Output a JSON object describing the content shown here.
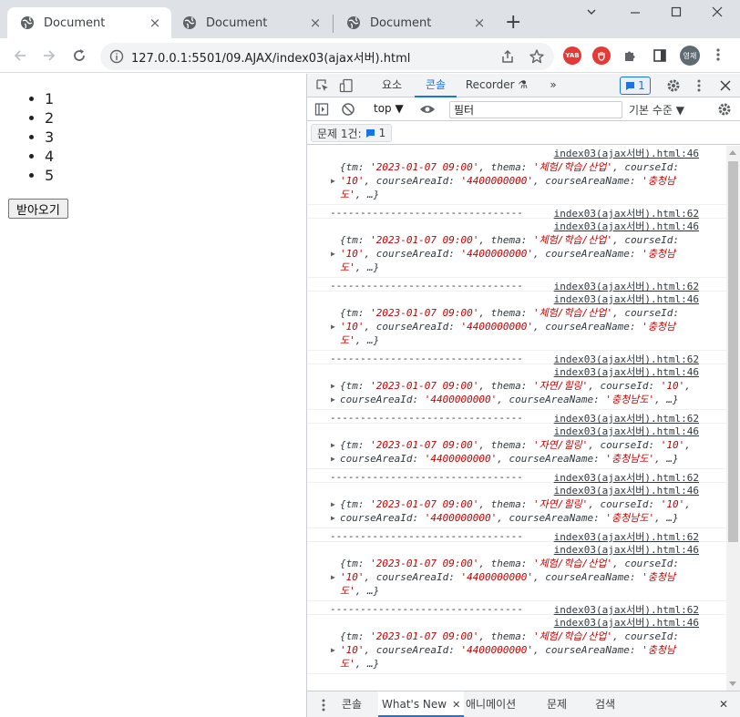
{
  "browser": {
    "tabs": [
      {
        "title": "Document",
        "close": "×"
      },
      {
        "title": "Document",
        "close": "×"
      },
      {
        "title": "Document",
        "close": "×"
      }
    ],
    "new_tab": "+",
    "window_controls": {
      "minimize": "—",
      "maximize": "☐",
      "close": "✕"
    },
    "url": "127.0.0.1:5501/09.AJAX/index03(ajax서버).html",
    "extensions": [
      {
        "label": "YAB",
        "color": "#e53935"
      },
      {
        "label": "",
        "color": "#e53935"
      }
    ],
    "profile_initials": "영재"
  },
  "page": {
    "list_items": [
      "1",
      "2",
      "3",
      "4",
      "5"
    ],
    "fetch_button": "받아오기"
  },
  "devtools": {
    "tabs": [
      "요소",
      "콘솔",
      "Recorder ⚗"
    ],
    "more_tabs": "»",
    "issue_count": "1",
    "context": "top ▼",
    "filter_placeholder": "필터",
    "level": "기본 수준 ▼",
    "issues_label": "문제 1건:",
    "issues_count": "1",
    "drawer_tabs": [
      "콘솔",
      "What's New",
      "애니메이션",
      "문제",
      "검색"
    ],
    "drawer_close": "✕",
    "drawer_tab_close": "✕"
  },
  "console": {
    "separator": "--------------------------------",
    "messages": [
      {
        "src": "index03(ajax서버).html:46",
        "lines": [
          [
            "{tm: ",
            "'2023-01-07 09:00'",
            ", thema: ",
            "'체험/학습/산업'",
            ", courseId:"
          ],
          [
            "",
            "'10'",
            ", courseAreaId: ",
            "'4400000000'",
            ", courseAreaName: ",
            "'충청남"
          ],
          [
            "",
            "도'",
            ", …}"
          ]
        ],
        "sep_src": "index03(ajax서버).html:62"
      },
      {
        "src": "index03(ajax서버).html:46",
        "lines": [
          [
            "{tm: ",
            "'2023-01-07 09:00'",
            ", thema: ",
            "'체험/학습/산업'",
            ", courseId:"
          ],
          [
            "",
            "'10'",
            ", courseAreaId: ",
            "'4400000000'",
            ", courseAreaName: ",
            "'충청남"
          ],
          [
            "",
            "도'",
            ", …}"
          ]
        ],
        "sep_src": "index03(ajax서버).html:62"
      },
      {
        "src": "index03(ajax서버).html:46",
        "lines": [
          [
            "{tm: ",
            "'2023-01-07 09:00'",
            ", thema: ",
            "'체험/학습/산업'",
            ", courseId:"
          ],
          [
            "",
            "'10'",
            ", courseAreaId: ",
            "'4400000000'",
            ", courseAreaName: ",
            "'충청남"
          ],
          [
            "",
            "도'",
            ", …}"
          ]
        ],
        "sep_src": "index03(ajax서버).html:62"
      },
      {
        "src": "index03(ajax서버).html:46",
        "lines": [
          [
            "{tm: ",
            "'2023-01-07 09:00'",
            ", thema: ",
            "'자연/힐링'",
            ", courseId: ",
            "'10'",
            ","
          ],
          [
            "courseAreaId: ",
            "'4400000000'",
            ", courseAreaName: ",
            "'충청남도'",
            ", …}"
          ]
        ],
        "sep_src": "index03(ajax서버).html:62"
      },
      {
        "src": "index03(ajax서버).html:46",
        "lines": [
          [
            "{tm: ",
            "'2023-01-07 09:00'",
            ", thema: ",
            "'자연/힐링'",
            ", courseId: ",
            "'10'",
            ","
          ],
          [
            "courseAreaId: ",
            "'4400000000'",
            ", courseAreaName: ",
            "'충청남도'",
            ", …}"
          ]
        ],
        "sep_src": "index03(ajax서버).html:62"
      },
      {
        "src": "index03(ajax서버).html:46",
        "lines": [
          [
            "{tm: ",
            "'2023-01-07 09:00'",
            ", thema: ",
            "'자연/힐링'",
            ", courseId: ",
            "'10'",
            ","
          ],
          [
            "courseAreaId: ",
            "'4400000000'",
            ", courseAreaName: ",
            "'충청남도'",
            ", …}"
          ]
        ],
        "sep_src": "index03(ajax서버).html:62"
      },
      {
        "src": "index03(ajax서버).html:46",
        "lines": [
          [
            "{tm: ",
            "'2023-01-07 09:00'",
            ", thema: ",
            "'체험/학습/산업'",
            ", courseId:"
          ],
          [
            "",
            "'10'",
            ", courseAreaId: ",
            "'4400000000'",
            ", courseAreaName: ",
            "'충청남"
          ],
          [
            "",
            "도'",
            ", …}"
          ]
        ],
        "sep_src": "index03(ajax서버).html:62"
      },
      {
        "src": "index03(ajax서버).html:46",
        "lines": [
          [
            "{tm: ",
            "'2023-01-07 09:00'",
            ", thema: ",
            "'체험/학습/산업'",
            ", courseId:"
          ],
          [
            "",
            "'10'",
            ", courseAreaId: ",
            "'4400000000'",
            ", courseAreaName: ",
            "'충청남"
          ],
          [
            "",
            "도'",
            ", …}"
          ]
        ],
        "sep_src": ""
      }
    ]
  },
  "colors": {
    "accent": "#1a73e8",
    "string": "#c80000",
    "tabstrip": "#dee1e6"
  }
}
